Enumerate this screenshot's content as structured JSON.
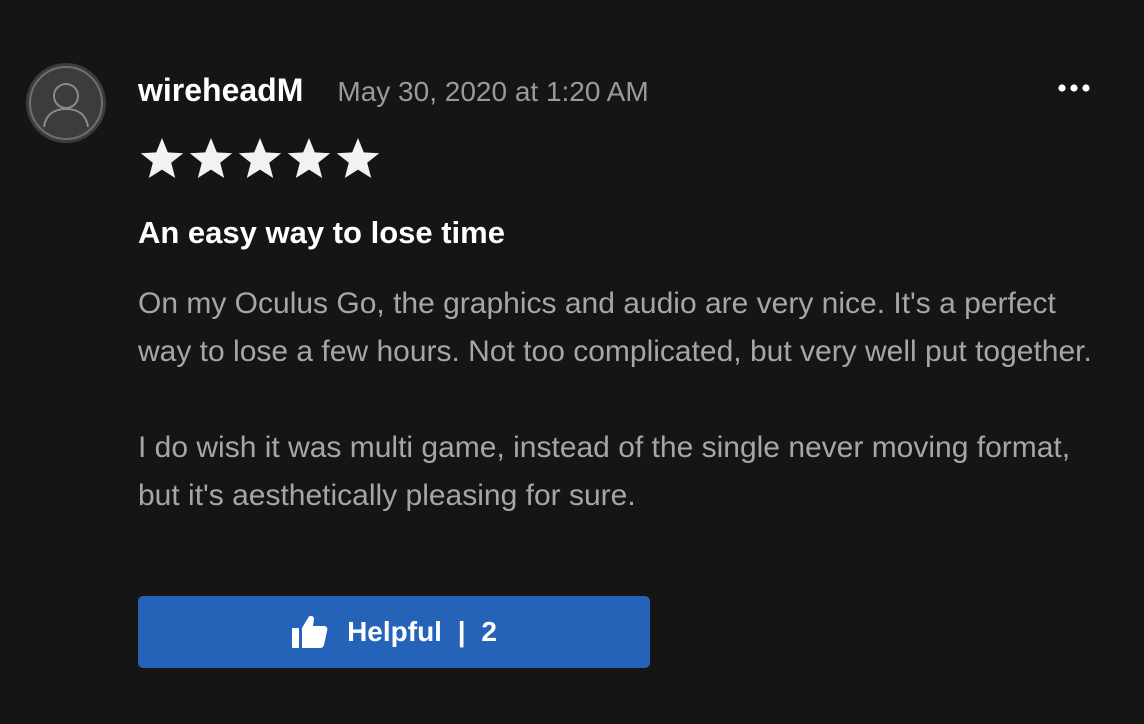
{
  "review": {
    "author": "wireheadM",
    "timestamp": "May 30, 2020 at 1:20 AM",
    "rating": 5,
    "rating_max": 5,
    "title": "An easy way to lose time",
    "paragraphs": [
      "On my Oculus Go, the graphics and audio are very nice. It's a perfect way to lose a few hours. Not too complicated, but very well put together.",
      "I do wish it was multi game, instead of the single never moving format, but it's aesthetically pleasing for sure."
    ]
  },
  "helpful": {
    "label": "Helpful",
    "separator": "|",
    "count": "2"
  },
  "icons": {
    "avatar": "user-silhouette-icon",
    "more": "more-options-icon",
    "star": "star-icon",
    "thumbs_up": "thumbs-up-icon"
  },
  "colors": {
    "background": "#151515",
    "accent": "#2563b9",
    "star": "#f2f2f2",
    "muted_text": "#a6a6a6"
  }
}
